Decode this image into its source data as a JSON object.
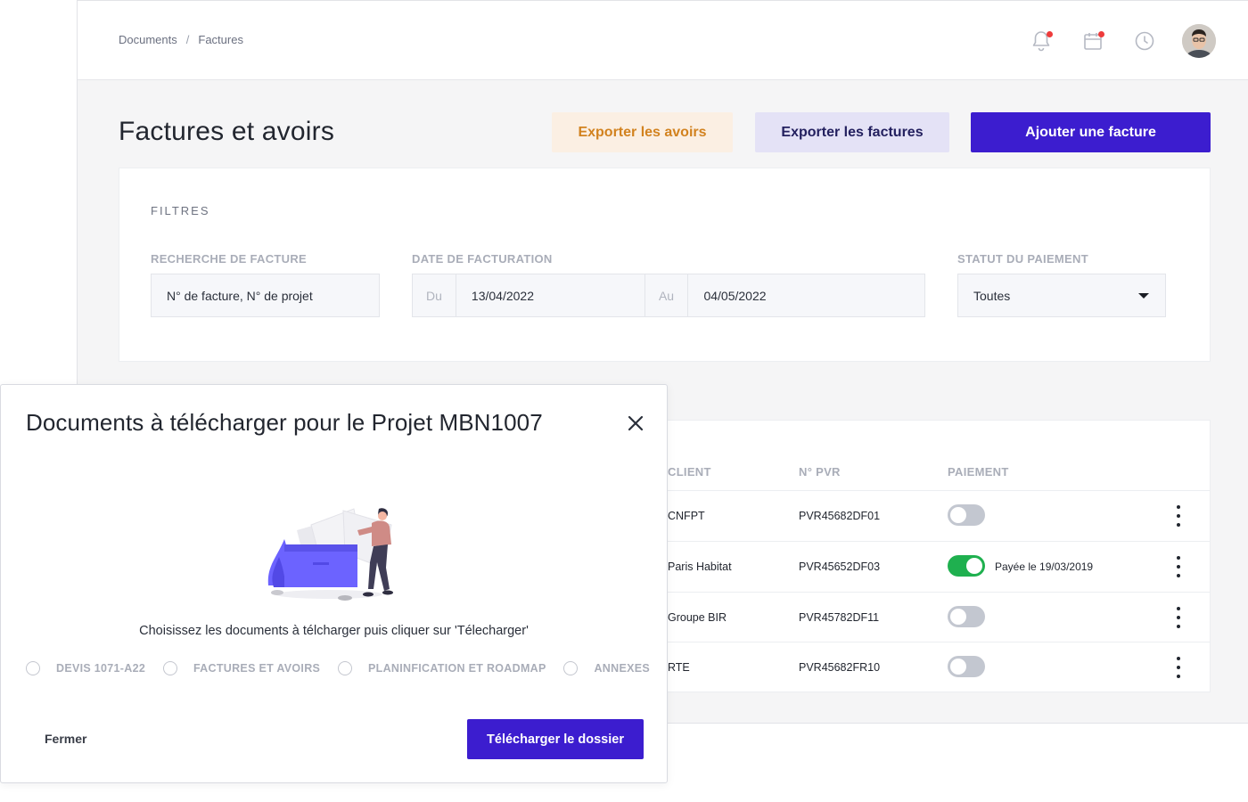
{
  "breadcrumb": {
    "root": "Documents",
    "separator": "/",
    "current": "Factures"
  },
  "topbar": {
    "icons": [
      "bell-icon",
      "calendar-icon",
      "clock-icon",
      "avatar"
    ],
    "notification_dot_color": "#ee3b3b"
  },
  "page": {
    "title": "Factures et avoirs",
    "export_avoirs_label": "Exporter les avoirs",
    "export_factures_label": "Exporter les factures",
    "add_invoice_label": "Ajouter une facture"
  },
  "filters": {
    "title": "FILTRES",
    "search_label": "RECHERCHE DE FACTURE",
    "search_placeholder": "N° de facture, N° de projet",
    "date_label": "DATE DE FACTURATION",
    "from_label": "Du",
    "from_value": "13/04/2022",
    "to_label": "Au",
    "to_value": "04/05/2022",
    "status_label": "STATUT DU PAIEMENT",
    "status_value": "Toutes"
  },
  "table": {
    "headers": {
      "client": "CLIENT",
      "pvr": "N° PVR",
      "payment": "PAIEMENT"
    },
    "rows": [
      {
        "client": "CNFPT",
        "pvr": "PVR45682DF01",
        "paid": false,
        "paid_text": ""
      },
      {
        "client": "Paris Habitat",
        "pvr": "PVR45652DF03",
        "paid": true,
        "paid_text": "Payée le 19/03/2019"
      },
      {
        "client": "Groupe BIR",
        "pvr": "PVR45782DF11",
        "paid": false,
        "paid_text": ""
      },
      {
        "client": "RTE",
        "pvr": "PVR45682FR10",
        "paid": false,
        "paid_text": ""
      }
    ]
  },
  "modal": {
    "title": "Documents à télécharger pour le Projet MBN1007",
    "hint": "Choisissez les documents à télcharger puis cliquer sur 'Télecharger'",
    "options": [
      "DEVIS 1071-A22",
      "FACTURES ET AVOIRS",
      "PLANINFICATION ET ROADMAP",
      "ANNEXES"
    ],
    "close_label": "Fermer",
    "download_label": "Télécharger le dossier"
  },
  "colors": {
    "primary": "#3c1dcf",
    "avoirs_bg": "#fbefe3",
    "avoirs_text": "#d2821f",
    "factures_bg": "#e4e2f6",
    "toggle_on": "#1fb04f",
    "toggle_off": "#c3c7d0"
  }
}
